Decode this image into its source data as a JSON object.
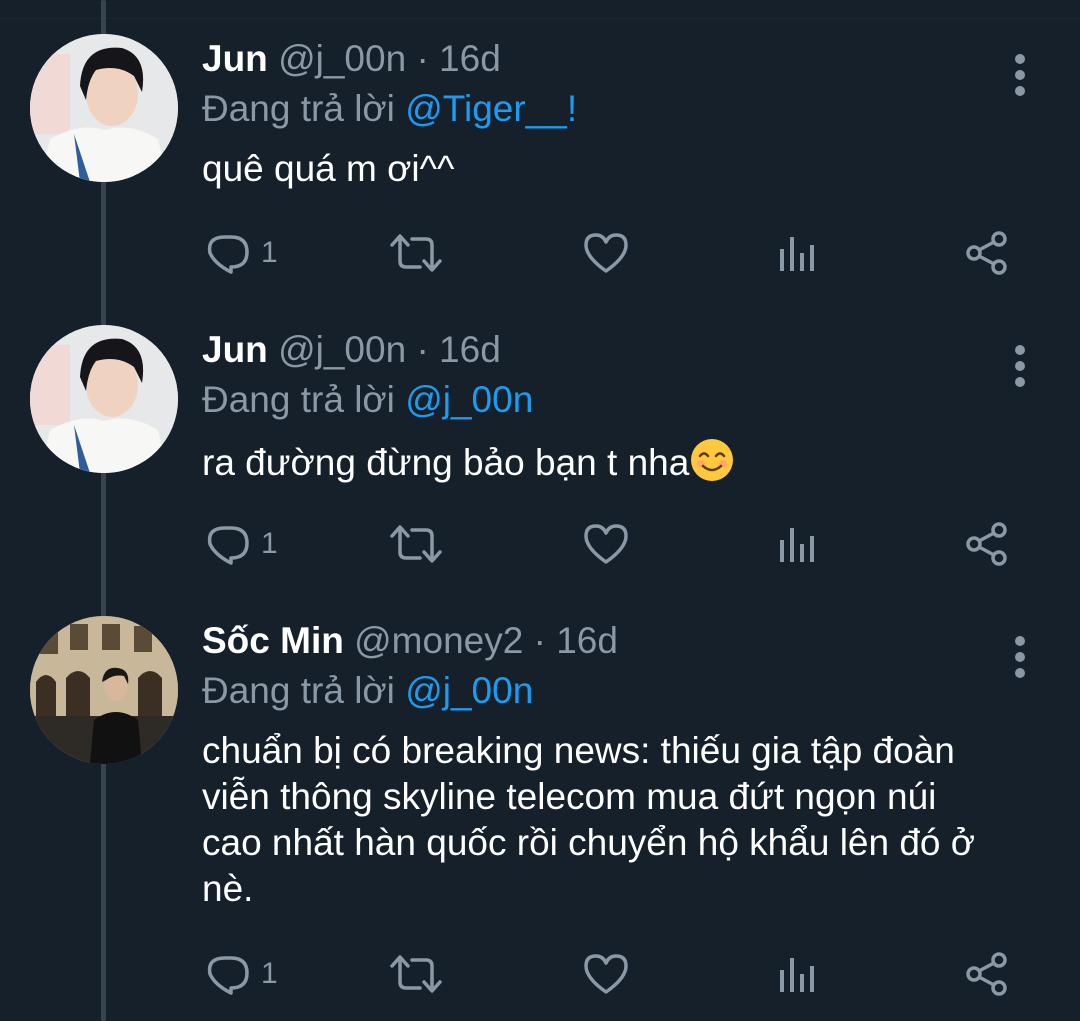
{
  "tweets": [
    {
      "name": "Jun",
      "handle": "@j_00n",
      "separator": "·",
      "time": "16d",
      "replying_prefix": "Đang trả lời",
      "replying_to": "@Tiger__!",
      "text": "quê quá m ơi^^",
      "reply_count": "1",
      "avatar": "avatar-photo"
    },
    {
      "name": "Jun",
      "handle": "@j_00n",
      "separator": "·",
      "time": "16d",
      "replying_prefix": "Đang trả lời",
      "replying_to": "@j_00n",
      "text": "ra đường đừng bảo bạn t nha",
      "emoji": "smiling-face-emoji",
      "reply_count": "1",
      "avatar": "avatar-photo"
    },
    {
      "name": "Sốc Min",
      "handle": "@money2",
      "separator": "·",
      "time": "16d",
      "replying_prefix": "Đang trả lời",
      "replying_to": "@j_00n",
      "text_lines": [
        "chuẩn bị có breaking news: thiếu gia tập đoàn",
        "viễn thông skyline telecom mua đứt ngọn núi",
        "cao nhất hàn quốc rồi chuyển hộ khẩu lên đó ở",
        "nè."
      ],
      "reply_count": "1",
      "avatar": "avatar-photo"
    }
  ],
  "icons": {
    "reply": "reply-icon",
    "retweet": "retweet-icon",
    "like": "heart-icon",
    "analytics": "analytics-icon",
    "share": "share-icon",
    "more": "more-vertical-icon"
  },
  "colors": {
    "background": "#15202b",
    "secondary_text": "#8b98a5",
    "mention": "#1d9bf0",
    "thread_line": "#38444d"
  }
}
